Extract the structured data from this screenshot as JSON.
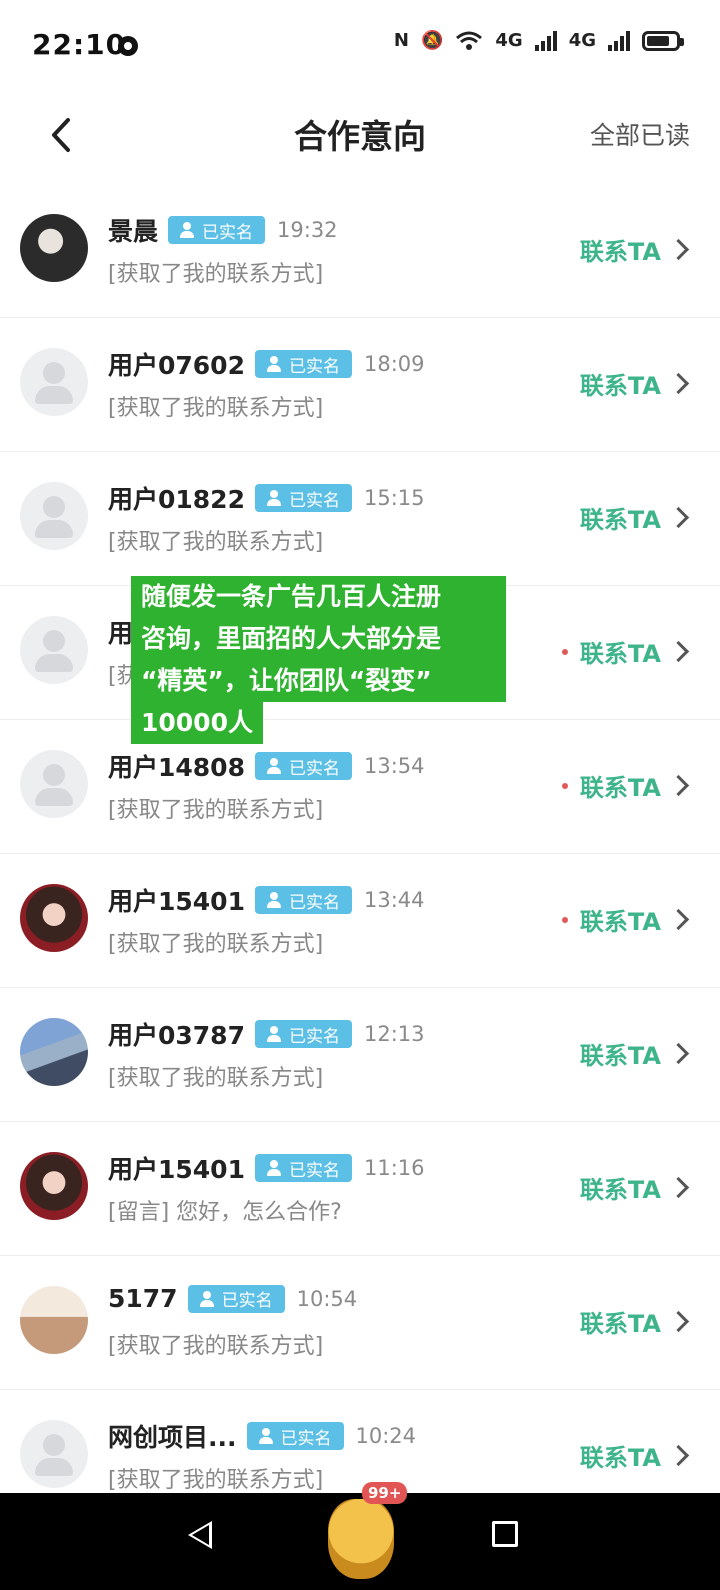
{
  "status_bar": {
    "time": "22:10",
    "icons": [
      "nfc-icon",
      "mute-icon",
      "wifi-icon",
      "signal-4g-icon",
      "signal-4g-icon",
      "battery-charging-icon"
    ],
    "signal_label_1": "4G",
    "signal_label_2": "4G"
  },
  "header": {
    "title": "合作意向",
    "mark_all_read": "全部已读"
  },
  "contact_label": "联系TA",
  "verified_label": "已实名",
  "items": [
    {
      "name": "景晨",
      "time": "19:32",
      "message": "[获取了我的联系方式]",
      "avatar": "photo",
      "unread": false
    },
    {
      "name": "用户07602",
      "time": "18:09",
      "message": "[获取了我的联系方式]",
      "avatar": "placeholder",
      "unread": false
    },
    {
      "name": "用户01822",
      "time": "15:15",
      "message": "[获取了我的联系方式]",
      "avatar": "placeholder",
      "unread": false
    },
    {
      "name": "用",
      "time": "",
      "message": "[获",
      "avatar": "placeholder",
      "unread": true
    },
    {
      "name": "用户14808",
      "time": "13:54",
      "message": "[获取了我的联系方式]",
      "avatar": "placeholder",
      "unread": true
    },
    {
      "name": "用户15401",
      "time": "13:44",
      "message": "[获取了我的联系方式]",
      "avatar": "photo",
      "unread": true
    },
    {
      "name": "用户03787",
      "time": "12:13",
      "message": "[获取了我的联系方式]",
      "avatar": "photo",
      "unread": false
    },
    {
      "name": "用户15401",
      "time": "11:16",
      "message": "[留言] 您好，怎么合作?",
      "avatar": "photo",
      "unread": false
    },
    {
      "name": "5177",
      "time": "10:54",
      "message": "[获取了我的联系方式]",
      "avatar": "photo",
      "unread": false
    },
    {
      "name": "网创项目...",
      "time": "10:24",
      "message": "[获取了我的联系方式]",
      "avatar": "placeholder",
      "unread": false
    }
  ],
  "overlay": {
    "lines": [
      "随便发一条广告几百人注册",
      "咨询，里面招的人大部分是",
      "“精英”，让你团队“裂变”",
      "10000人"
    ],
    "color": "#2fb22f"
  },
  "system_nav": {
    "badge": "99+"
  },
  "colors": {
    "accent_green": "#3db48a",
    "badge_blue": "#5bbfe6",
    "unread_dot": "#e05a5a"
  }
}
